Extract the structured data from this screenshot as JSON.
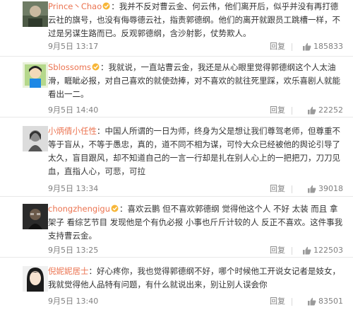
{
  "colors": {
    "accent": "#eb7350",
    "meta": "#808080",
    "divider": "#e8e8e8"
  },
  "comments": [
    {
      "username": "Prince丶Chao",
      "text": "：我并不反对曹云金、何云伟，他们离开后，似乎并没有再打德云社的旗号，也没有侮辱德云社，指责郭德纲。他们的离开就跟员工跳槽一样，不过是另谋生路而已。反观郭德纲，含沙射影，仗势欺人。",
      "time": "9月5日 13:17",
      "reply": "回复",
      "likes": "185833"
    },
    {
      "username": "Sblossoms",
      "text": "：我就说，一直站曹云金，我还是从心眼里觉得郭德纲这个人太油滑，睚眦必报，对自己喜欢的就使劲捧，对不喜欢的就往死里踩，欢乐喜剧人就能看出一二。",
      "time": "9月5日 14:40",
      "reply": "回复",
      "likes": "22252"
    },
    {
      "username": "小炳倩小任性",
      "text": "：中国人所谓的一日为师，终身为父是想让我们尊驾老师，但尊重不等于盲从，不等于愚忠，真的，道不同不相为谋，可怜大众已经被他的舆论引导了太久，盲目跟风，却不知道自己的一言一行却是扎在别人心上的一把把刀，刀刀见血，直指人心，可悲，可拉",
      "time": "9月5日 13:34",
      "reply": "回复",
      "likes": "39018"
    },
    {
      "username": "chongzhengigu",
      "text": "：喜欢云鹏 但不喜欢郭德纲 觉得他这个人 不好 太装 而且 拿架子 看综艺节目 发现他是个有仇必报 小事也斤斤计较的人 反正不喜欢。这件事我支持曹云金。",
      "time": "9月5日 13:25",
      "reply": "回复",
      "likes": "122503"
    },
    {
      "username": "倪妮妮居士",
      "text": "：好心疼你，我也觉得郭德纲不好，哪个时候他工开说女记者是妓女，我就觉得他人品特有问题，有什么就说出来，别让别人误会你",
      "time": "9月5日 13:40",
      "reply": "回复",
      "likes": "83501"
    }
  ]
}
